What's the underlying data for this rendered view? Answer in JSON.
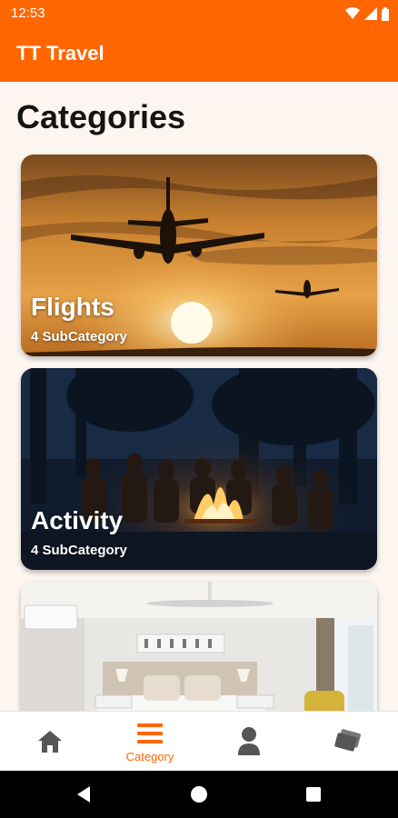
{
  "status_bar": {
    "time": "12:53",
    "icons": [
      "wifi-icon",
      "signal-icon",
      "battery-icon"
    ]
  },
  "app_bar": {
    "title": "TT Travel",
    "color": "#ff6600"
  },
  "page": {
    "title": "Categories"
  },
  "categories": [
    {
      "title": "Flights",
      "subtitle": "4 SubCategory"
    },
    {
      "title": "Activity",
      "subtitle": "4 SubCategory"
    },
    {
      "title": "",
      "subtitle": ""
    }
  ],
  "bottom_nav": {
    "items": [
      {
        "icon": "home-icon",
        "label": ""
      },
      {
        "icon": "menu-icon",
        "label": "Category",
        "active": true
      },
      {
        "icon": "person-icon",
        "label": ""
      },
      {
        "icon": "tickets-icon",
        "label": ""
      }
    ],
    "accent": "#ff6600",
    "inactive": "#555555"
  },
  "system_nav": {
    "icons": [
      "back-icon",
      "home-circle-icon",
      "recents-icon"
    ]
  }
}
